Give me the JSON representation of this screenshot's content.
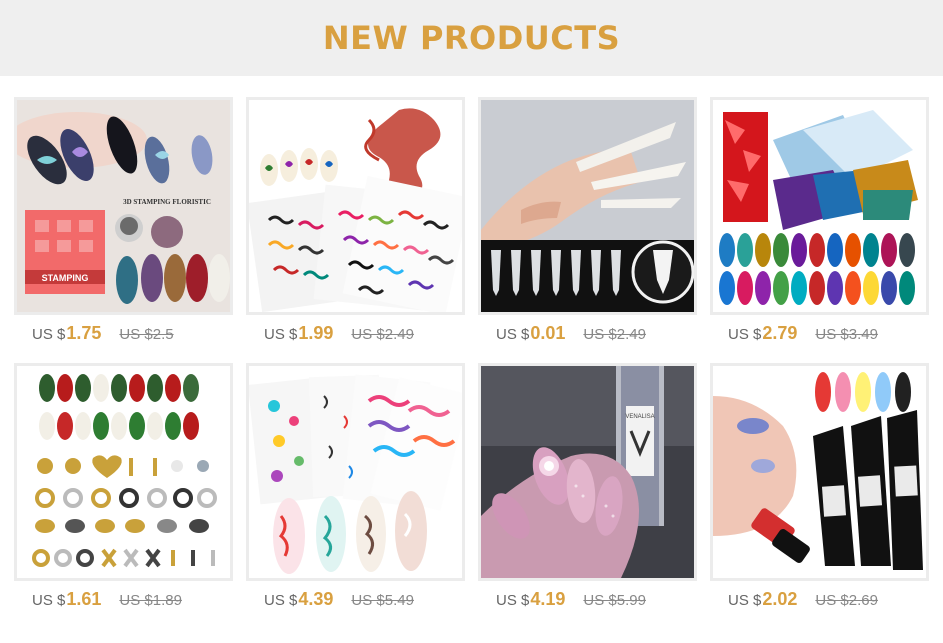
{
  "header": {
    "title": "NEW PRODUCTS"
  },
  "colors": {
    "accent": "#d9a040",
    "header_bg": "#efefef",
    "frame": "#ececec"
  },
  "products": [
    {
      "currency": "US $",
      "price": "1.75",
      "old_price": "US $2.5",
      "image": "3d-stamping-floristic-nails",
      "image_text": [
        "3D STAMPING FLORISTIC",
        "STAMPING"
      ]
    },
    {
      "currency": "US $",
      "price": "1.99",
      "old_price": "US $2.49",
      "image": "dragon-nail-sticker-sheets"
    },
    {
      "currency": "US $",
      "price": "0.01",
      "old_price": "US $2.49",
      "image": "clear-stiletto-nail-tips"
    },
    {
      "currency": "US $",
      "price": "2.79",
      "old_price": "US $3.49",
      "image": "holographic-nail-foils"
    },
    {
      "currency": "US $",
      "price": "1.61",
      "old_price": "US $1.89",
      "image": "nail-charms-and-decals"
    },
    {
      "currency": "US $",
      "price": "4.39",
      "old_price": "US $5.49",
      "image": "watercolor-nail-stickers"
    },
    {
      "currency": "US $",
      "price": "4.19",
      "old_price": "US $5.99",
      "image": "glitter-gel-polish-bottle",
      "image_text": [
        "VENALISA"
      ]
    },
    {
      "currency": "US $",
      "price": "2.02",
      "old_price": "US $2.69",
      "image": "poly-gel-tubes"
    }
  ]
}
